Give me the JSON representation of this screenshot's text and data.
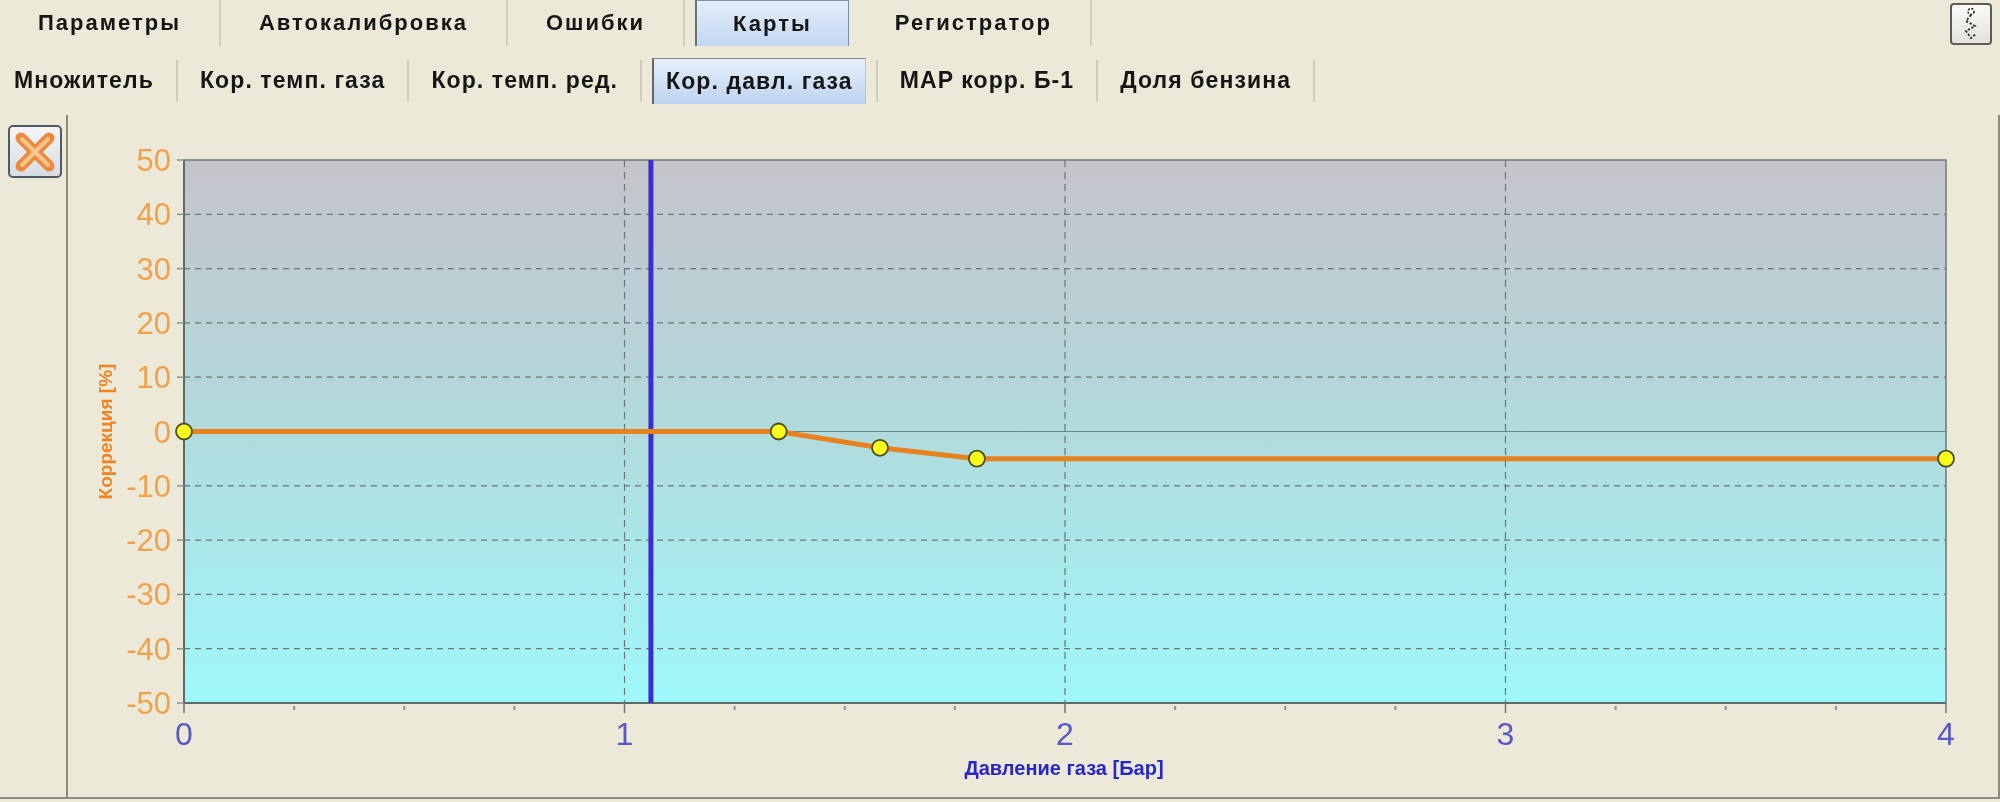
{
  "top_tabs": [
    {
      "label": "Параметры",
      "selected": false
    },
    {
      "label": "Автокалибровка",
      "selected": false
    },
    {
      "label": "Ошибки",
      "selected": false
    },
    {
      "label": "Карты",
      "selected": true
    },
    {
      "label": "Регистратор",
      "selected": false
    }
  ],
  "sub_tabs": [
    {
      "label": "Множитель",
      "selected": false
    },
    {
      "label": "Кор. темп. газа",
      "selected": false
    },
    {
      "label": "Кор. темп. ред.",
      "selected": false
    },
    {
      "label": "Кор. давл. газа",
      "selected": true
    },
    {
      "label": "MAP корр. Б-1",
      "selected": false
    },
    {
      "label": "Доля бензина",
      "selected": false
    }
  ],
  "chart": {
    "chart_data": {
      "type": "line",
      "xlabel": "Давление газа [Бар]",
      "ylabel": "Коррекция [%]",
      "x": [
        0,
        1.35,
        1.58,
        1.8,
        4
      ],
      "series": [
        {
          "color": "#e8821e",
          "marker": "circle",
          "values": [
            0,
            0,
            -3,
            -5,
            -5
          ]
        }
      ],
      "xlim": [
        0,
        4
      ],
      "ylim": [
        -50,
        50
      ],
      "xticks": [
        0,
        1,
        2,
        3,
        4
      ],
      "yticks": [
        -50,
        -40,
        -30,
        -20,
        -10,
        0,
        10,
        20,
        30,
        40,
        50
      ],
      "grid": true,
      "ref_lines": [
        {
          "axis": "x",
          "value": 1.06,
          "color": "#3c2ecc"
        }
      ]
    }
  }
}
